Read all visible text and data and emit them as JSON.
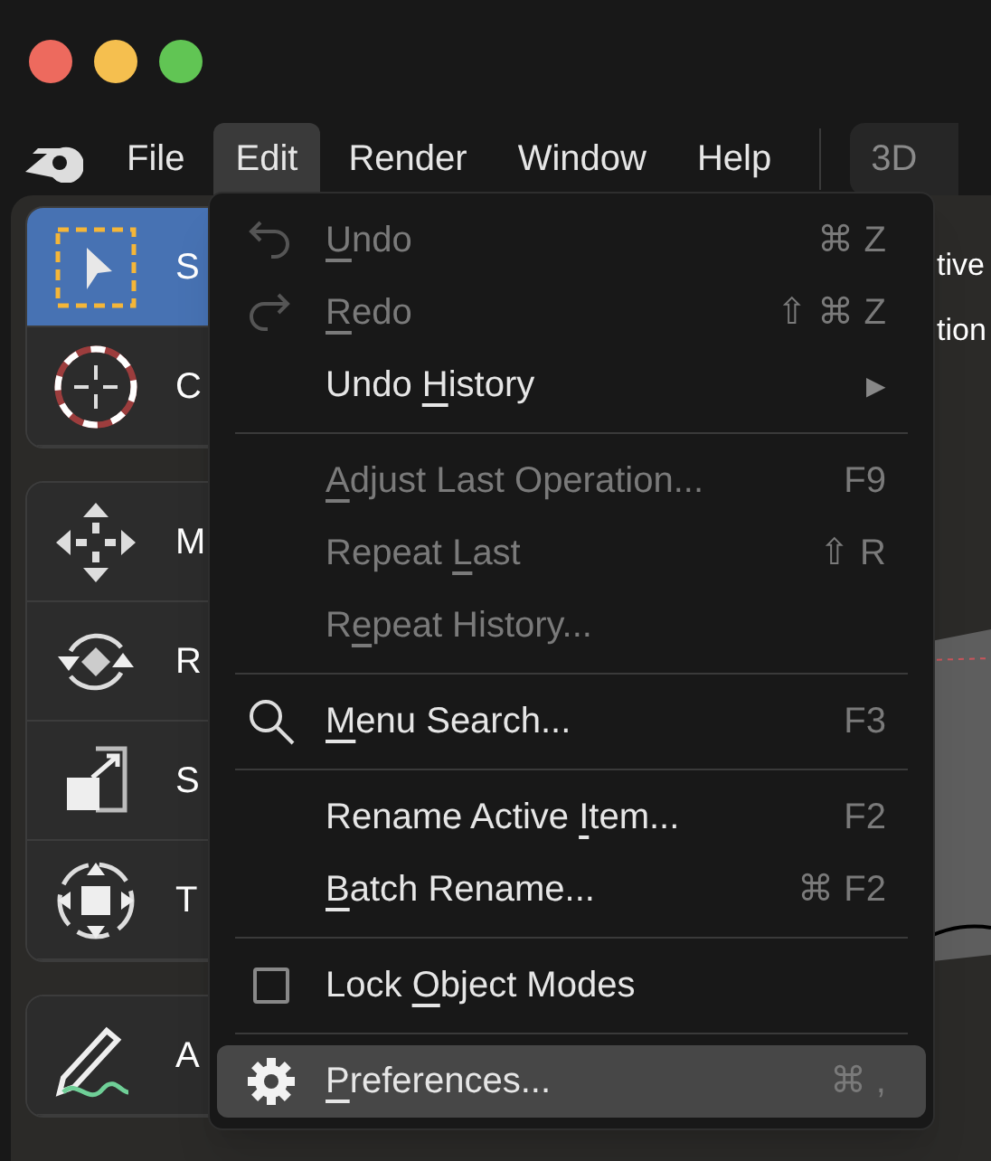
{
  "menubar": {
    "items": [
      {
        "label": "File",
        "selected": false
      },
      {
        "label": "Edit",
        "selected": true
      },
      {
        "label": "Render",
        "selected": false
      },
      {
        "label": "Window",
        "selected": false
      },
      {
        "label": "Help",
        "selected": false
      }
    ],
    "workspace_tab": "3D"
  },
  "toolbar": {
    "groups": [
      [
        {
          "label": "S",
          "selected": true
        },
        {
          "label": "C",
          "selected": false
        }
      ],
      [
        {
          "label": "M",
          "selected": false
        },
        {
          "label": "R",
          "selected": false
        },
        {
          "label": "S",
          "selected": false
        },
        {
          "label": "T",
          "selected": false
        }
      ],
      [
        {
          "label": "A",
          "selected": false
        }
      ]
    ]
  },
  "viewport": {
    "lines": [
      "tive",
      "tion"
    ]
  },
  "edit_menu": {
    "items": [
      {
        "kind": "item",
        "label": {
          "key": "U",
          "after": "ndo"
        },
        "shortcut": "⌘ Z",
        "disabled": true,
        "selected": false
      },
      {
        "kind": "item",
        "label": {
          "key": "R",
          "after": "edo"
        },
        "shortcut": "⇧ ⌘ Z",
        "disabled": true,
        "selected": false
      },
      {
        "kind": "submenu",
        "label": {
          "before": "Undo ",
          "key": "H",
          "after": "istory"
        },
        "arrow": "▶",
        "disabled": false,
        "selected": false
      },
      {
        "kind": "separator"
      },
      {
        "kind": "item",
        "label": {
          "key": "A",
          "after": "djust Last Operation..."
        },
        "shortcut": "F9",
        "disabled": true,
        "selected": false
      },
      {
        "kind": "item",
        "label": {
          "before": "Repeat ",
          "key": "L",
          "after": "ast"
        },
        "shortcut": "⇧ R",
        "disabled": true,
        "selected": false
      },
      {
        "kind": "item",
        "label": {
          "before": "R",
          "key": "e",
          "after": "peat History..."
        },
        "disabled": true,
        "selected": false
      },
      {
        "kind": "separator"
      },
      {
        "kind": "item",
        "label": {
          "key": "M",
          "after": "enu Search..."
        },
        "shortcut": "F3",
        "disabled": false,
        "selected": false
      },
      {
        "kind": "separator"
      },
      {
        "kind": "item",
        "label": {
          "before": "Rename Active ",
          "key": "I",
          "after": "tem..."
        },
        "shortcut": "F2",
        "disabled": false,
        "selected": false
      },
      {
        "kind": "item",
        "label": {
          "key": "B",
          "after": "atch Rename..."
        },
        "shortcut": "⌘ F2",
        "disabled": false,
        "selected": false
      },
      {
        "kind": "separator"
      },
      {
        "kind": "checkbox",
        "label": {
          "before": "Lock ",
          "key": "O",
          "after": "bject Modes"
        },
        "checked": false,
        "disabled": false,
        "selected": false
      },
      {
        "kind": "separator"
      },
      {
        "kind": "item",
        "label": {
          "key": "P",
          "after": "references..."
        },
        "shortcut": "⌘ ,",
        "disabled": false,
        "selected": true
      }
    ]
  }
}
